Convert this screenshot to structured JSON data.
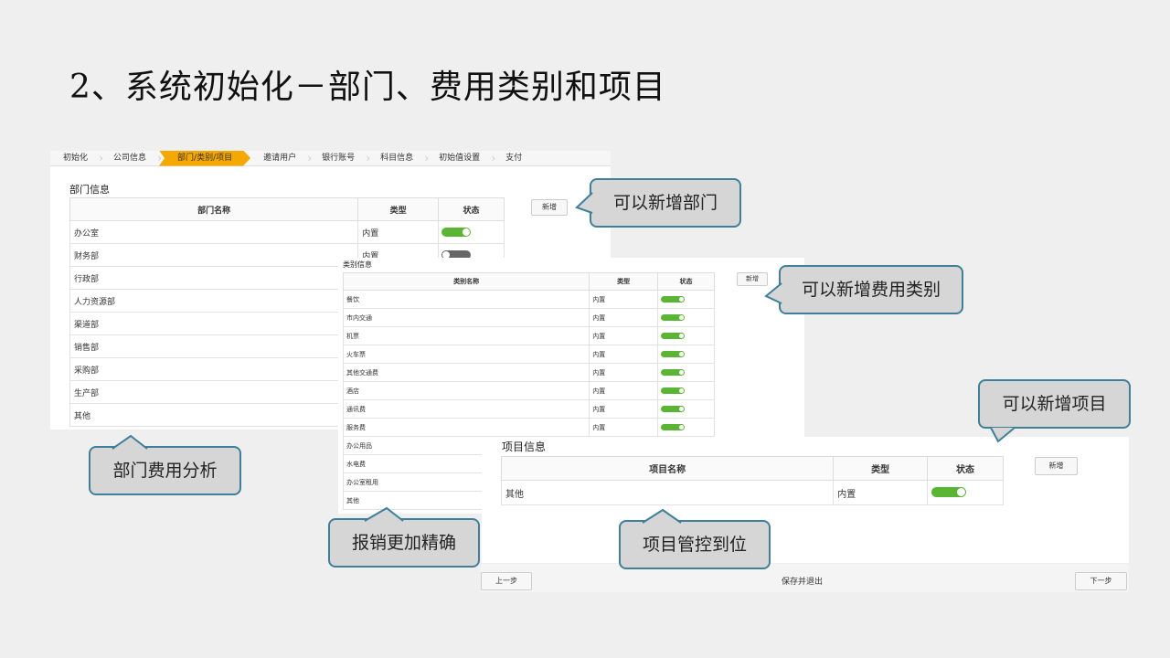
{
  "title": "2、系统初始化－部门、费用类别和项目",
  "steps": [
    "初始化",
    "公司信息",
    "部门/类别/项目",
    "邀请用户",
    "银行账号",
    "科目信息",
    "初始值设置",
    "支付"
  ],
  "active_step": "部门/类别/项目",
  "dept": {
    "section_title": "部门信息",
    "headers": [
      "部门名称",
      "类型",
      "状态"
    ],
    "add_label": "新增",
    "rows": [
      {
        "name": "办公室",
        "type": "内置",
        "status": "on"
      },
      {
        "name": "财务部",
        "type": "内置",
        "status": "off"
      },
      {
        "name": "行政部",
        "type": "",
        "status": ""
      },
      {
        "name": "人力资源部",
        "type": "",
        "status": ""
      },
      {
        "name": "渠道部",
        "type": "",
        "status": ""
      },
      {
        "name": "销售部",
        "type": "",
        "status": ""
      },
      {
        "name": "采购部",
        "type": "",
        "status": ""
      },
      {
        "name": "生产部",
        "type": "",
        "status": ""
      },
      {
        "name": "其他",
        "type": "",
        "status": ""
      }
    ]
  },
  "category": {
    "section_title": "类别信息",
    "headers": [
      "类别名称",
      "类型",
      "状态"
    ],
    "add_label": "新增",
    "rows": [
      {
        "name": "餐饮",
        "type": "内置",
        "status": "on"
      },
      {
        "name": "市内交通",
        "type": "内置",
        "status": "on"
      },
      {
        "name": "机票",
        "type": "内置",
        "status": "on"
      },
      {
        "name": "火车票",
        "type": "内置",
        "status": "on"
      },
      {
        "name": "其他交通费",
        "type": "内置",
        "status": "on"
      },
      {
        "name": "酒店",
        "type": "内置",
        "status": "on"
      },
      {
        "name": "通讯费",
        "type": "内置",
        "status": "on"
      },
      {
        "name": "服务费",
        "type": "内置",
        "status": "on"
      },
      {
        "name": "办公用品",
        "type": "",
        "status": ""
      },
      {
        "name": "水电费",
        "type": "",
        "status": ""
      },
      {
        "name": "办公室租用",
        "type": "",
        "status": ""
      },
      {
        "name": "其他",
        "type": "",
        "status": ""
      }
    ]
  },
  "project": {
    "section_title": "项目信息",
    "headers": [
      "项目名称",
      "类型",
      "状态"
    ],
    "add_label": "新增",
    "rows": [
      {
        "name": "其他",
        "type": "内置",
        "status": "on"
      }
    ]
  },
  "footer": {
    "prev_label": "上一步",
    "save_exit_label": "保存并退出",
    "next_label": "下一步"
  },
  "callouts": {
    "add_dept": "可以新增部门",
    "add_category": "可以新增费用类别",
    "add_project": "可以新增项目",
    "dept_analysis": "部门费用分析",
    "expense_precise": "报销更加精确",
    "project_control": "项目管控到位"
  }
}
